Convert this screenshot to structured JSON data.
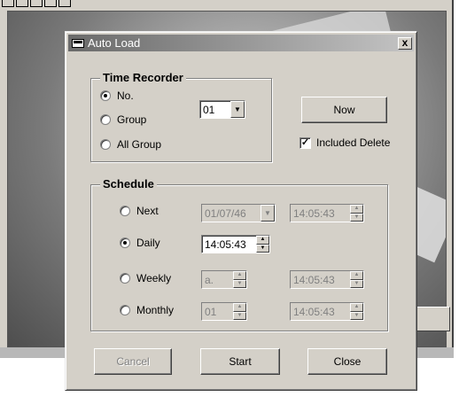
{
  "dialog": {
    "title": "Auto Load",
    "close_glyph": "x"
  },
  "time_recorder": {
    "title": "Time Recorder",
    "options": [
      "No.",
      "Group",
      "All Group"
    ],
    "selected": "No.",
    "number_value": "01"
  },
  "now_button": "Now",
  "included_delete": {
    "label": "Included Delete",
    "checked": true,
    "check_glyph": "✓"
  },
  "schedule": {
    "title": "Schedule",
    "next": {
      "label": "Next",
      "date": "01/07/46",
      "time": "14:05:43"
    },
    "daily": {
      "label": "Daily",
      "time": "14:05:43",
      "selected": true
    },
    "weekly": {
      "label": "Weekly",
      "day": "a.",
      "time": "14:05:43"
    },
    "monthly": {
      "label": "Monthly",
      "day": "01",
      "time": "14:05:43"
    }
  },
  "buttons": {
    "cancel": "Cancel",
    "start": "Start",
    "close": "Close"
  },
  "icons": {
    "title_icon": "window-icon",
    "combo_arrow": "▼",
    "spin_up": "▲",
    "spin_down": "▼"
  }
}
